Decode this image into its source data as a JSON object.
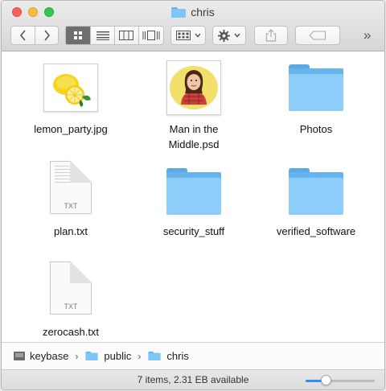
{
  "window": {
    "title": "chris"
  },
  "toolbar": {
    "overflow_label": "»"
  },
  "files": [
    {
      "name_line1": "lemon_party.jpg",
      "name_line2": ""
    },
    {
      "name_line1": "Man in the",
      "name_line2": "Middle.psd"
    },
    {
      "name_line1": "Photos",
      "name_line2": ""
    },
    {
      "name_line1": "plan.txt",
      "name_line2": ""
    },
    {
      "name_line1": "security_stuff",
      "name_line2": ""
    },
    {
      "name_line1": "verified_software",
      "name_line2": ""
    },
    {
      "name_line1": "zerocash.txt",
      "name_line2": ""
    }
  ],
  "file_type_badges": {
    "plan": "TXT",
    "zerocash": "TXT"
  },
  "pathbar": {
    "items": [
      "keybase",
      "public",
      "chris"
    ],
    "separator": "›"
  },
  "status": {
    "text": "7 items, 2.31 EB available",
    "icon_size_level": 0.26
  },
  "colors": {
    "folder": "#8ccdf9",
    "accent": "#2f8ff5"
  }
}
